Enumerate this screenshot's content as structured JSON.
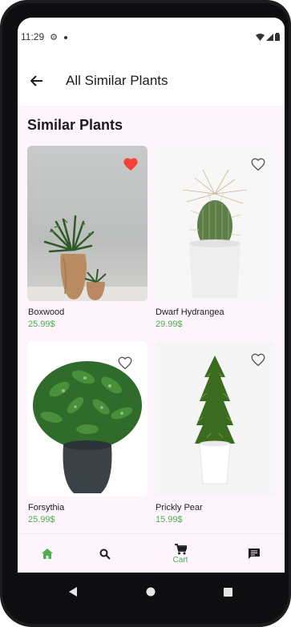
{
  "status_bar": {
    "time": "11:29",
    "icons": [
      "gear-icon",
      "notification-dot-icon",
      "wifi-icon",
      "signal-icon",
      "battery-icon"
    ]
  },
  "app_bar": {
    "back_icon": "arrow-back-icon",
    "title": "All Similar Plants"
  },
  "section_title": "Similar Plants",
  "plants": [
    {
      "name": "Boxwood",
      "price": "25.99$",
      "favorite": true
    },
    {
      "name": "Dwarf Hydrangea",
      "price": "29.99$",
      "favorite": false
    },
    {
      "name": "Forsythia",
      "price": "25.99$",
      "favorite": false
    },
    {
      "name": "Prickly Pear",
      "price": "15.99$",
      "favorite": false
    }
  ],
  "bottom_nav": {
    "items": [
      {
        "icon": "home-icon",
        "label": ""
      },
      {
        "icon": "search-icon",
        "label": ""
      },
      {
        "icon": "cart-icon",
        "label": "Cart",
        "active": true
      },
      {
        "icon": "chat-icon",
        "label": ""
      }
    ]
  },
  "system_nav": [
    "back-triangle-icon",
    "home-circle-icon",
    "recents-square-icon"
  ],
  "colors": {
    "accent_green": "#4caf50",
    "favorite_red": "#f44336",
    "screen_background": "#fdf5fb"
  }
}
